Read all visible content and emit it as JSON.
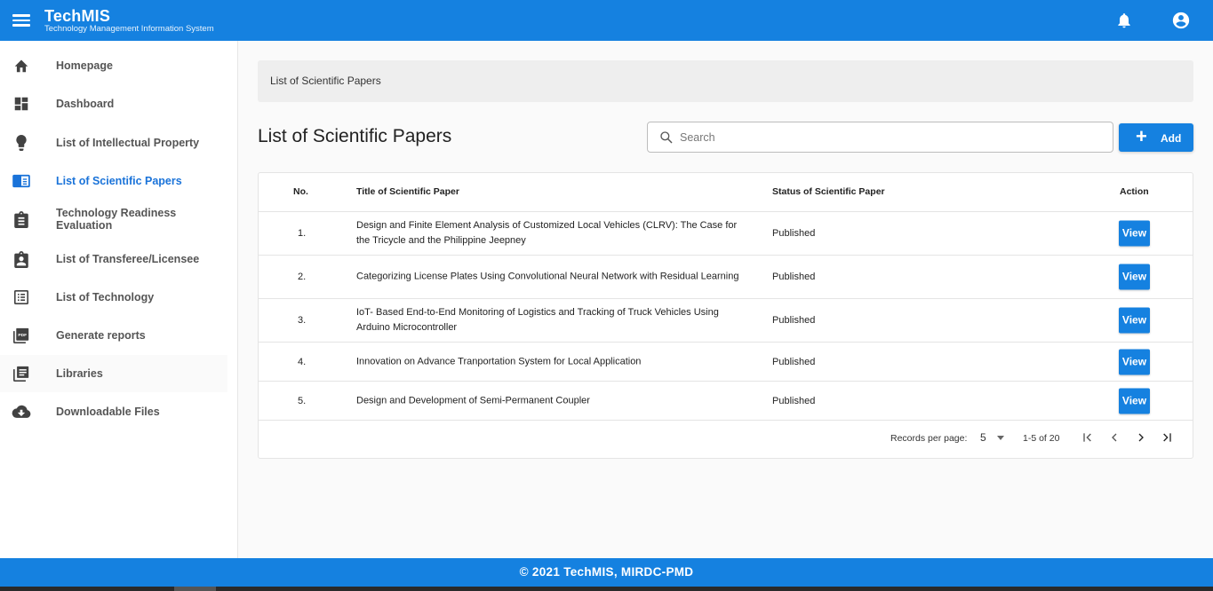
{
  "header": {
    "app_name": "TechMIS",
    "app_subtitle": "Technology Management Information System",
    "menu_icon": "hamburger-menu-icon",
    "notification_icon": "bell-icon",
    "account_icon": "account-circle-icon",
    "color": "#1581e0"
  },
  "sidebar": {
    "items": [
      {
        "label": "Homepage",
        "icon": "home-icon"
      },
      {
        "label": "Dashboard",
        "icon": "dashboard-icon"
      },
      {
        "label": "List of Intellectual Property",
        "icon": "lightbulb-icon"
      },
      {
        "label": "List of Scientific Papers",
        "icon": "book-open-icon",
        "active": true
      },
      {
        "label": "Technology Readiness Evaluation",
        "icon": "clipboard-list-icon"
      },
      {
        "label": "List of Transferee/Licensee",
        "icon": "clipboard-account-icon"
      },
      {
        "label": "List of Technology",
        "icon": "list-box-icon"
      },
      {
        "label": "Generate reports",
        "icon": "pdf-file-icon"
      },
      {
        "label": "Libraries",
        "icon": "library-icon"
      },
      {
        "label": "Downloadable Files",
        "icon": "cloud-download-icon"
      }
    ],
    "active_color": "#1a73d9"
  },
  "breadcrumb": {
    "text": "List of Scientific Papers"
  },
  "main": {
    "title": "List of Scientific Papers",
    "search_placeholder": "Search",
    "search_value": "",
    "add_label": "Add"
  },
  "table": {
    "headers": {
      "no": "No.",
      "title": "Title of Scientific Paper",
      "status": "Status of Scientific Paper",
      "action": "Action"
    },
    "rows": [
      {
        "no": "1.",
        "title": "Design and Finite Element Analysis of Customized Local Vehicles (CLRV): The Case for the Tricycle and the Philippine Jeepney",
        "status": "Published",
        "action": "View"
      },
      {
        "no": "2.",
        "title": "Categorizing License Plates Using Convolutional Neural Network with Residual Learning",
        "status": "Published",
        "action": "View"
      },
      {
        "no": "3.",
        "title": "IoT- Based End-to-End Monitoring of Logistics and Tracking of Truck Vehicles Using Arduino Microcontroller",
        "status": "Published",
        "action": "View"
      },
      {
        "no": "4.",
        "title": "Innovation on Advance Tranportation System for Local Application",
        "status": "Published",
        "action": "View"
      },
      {
        "no": "5.",
        "title": "Design and Development of Semi-Permanent Coupler",
        "status": "Published",
        "action": "View"
      }
    ]
  },
  "pagination": {
    "records_label": "Records per page:",
    "records_value": "5",
    "range": "1-5 of 20"
  },
  "footer": {
    "text": "© 2021 TechMIS, MIRDC-PMD"
  }
}
